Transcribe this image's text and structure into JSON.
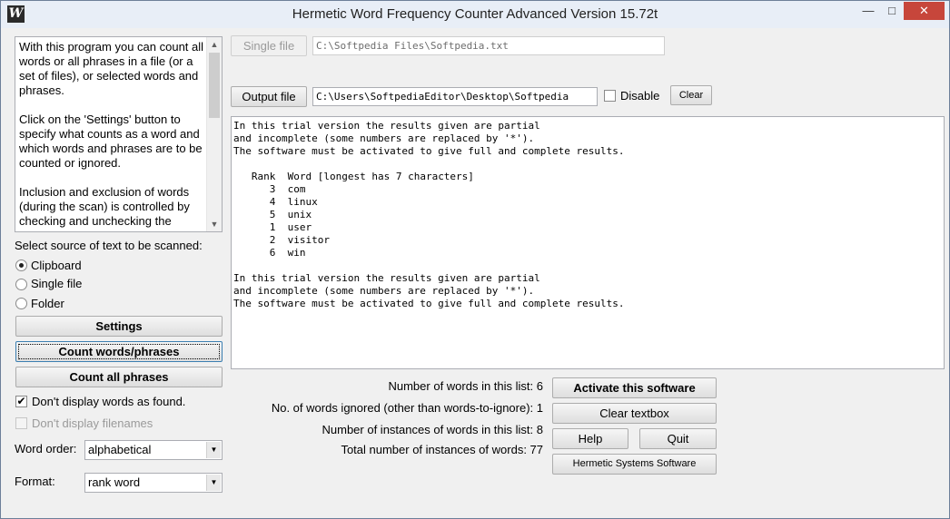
{
  "window": {
    "title": "Hermetic Word Frequency Counter Advanced Version 15.72t",
    "icon_letter": "W",
    "min_glyph": "—",
    "max_glyph": "□",
    "close_glyph": "✕"
  },
  "help": {
    "paragraphs": [
      "With this program you can count all words or all phrases in a file (or a set of files), or selected words and phrases.",
      "Click on the 'Settings' button to specify what counts as a word and which words and phrases are to be counted or ignored.",
      "Inclusion and exclusion of words (during the scan) is controlled by checking and unchecking the"
    ]
  },
  "source": {
    "label": "Select source of text to be scanned:",
    "options": [
      "Clipboard",
      "Single file",
      "Folder"
    ],
    "selected": "Clipboard"
  },
  "buttons": {
    "settings": "Settings",
    "count_words": "Count words/phrases",
    "count_phrases": "Count all phrases",
    "single_file": "Single file",
    "output_file": "Output file",
    "clear": "Clear",
    "activate": "Activate this software",
    "clear_textbox": "Clear textbox",
    "help": "Help",
    "quit": "Quit",
    "hermetic": "Hermetic Systems Software"
  },
  "options": {
    "dont_display_words": "Don't display words as found.",
    "dont_display_filenames": "Don't display filenames",
    "word_order_label": "Word order:",
    "word_order_value": "alphabetical",
    "format_label": "Format:",
    "format_value": "rank word",
    "disable_label": "Disable"
  },
  "files": {
    "single_file_path": "C:\\Softpedia Files\\Softpedia.txt",
    "output_file_path": "C:\\Users\\SoftpediaEditor\\Desktop\\Softpedia"
  },
  "results": {
    "notice": [
      "In this trial version the results given are partial",
      "and incomplete (some numbers are replaced by '*').",
      "The software must be activated to give full and complete results."
    ],
    "header_rank": "Rank",
    "header_word": "Word [longest has 7 characters]",
    "rows": [
      {
        "rank": "3",
        "word": "com"
      },
      {
        "rank": "4",
        "word": "linux"
      },
      {
        "rank": "5",
        "word": "unix"
      },
      {
        "rank": "1",
        "word": "user"
      },
      {
        "rank": "2",
        "word": "visitor"
      },
      {
        "rank": "6",
        "word": "win"
      }
    ]
  },
  "stats": {
    "words_in_list": "Number of words in this list: 6",
    "words_ignored": "No. of words ignored (other than words-to-ignore): 1",
    "instances_in_list": "Number of instances of words in this list: 8",
    "total_instances": "Total number of instances of words: 77"
  }
}
